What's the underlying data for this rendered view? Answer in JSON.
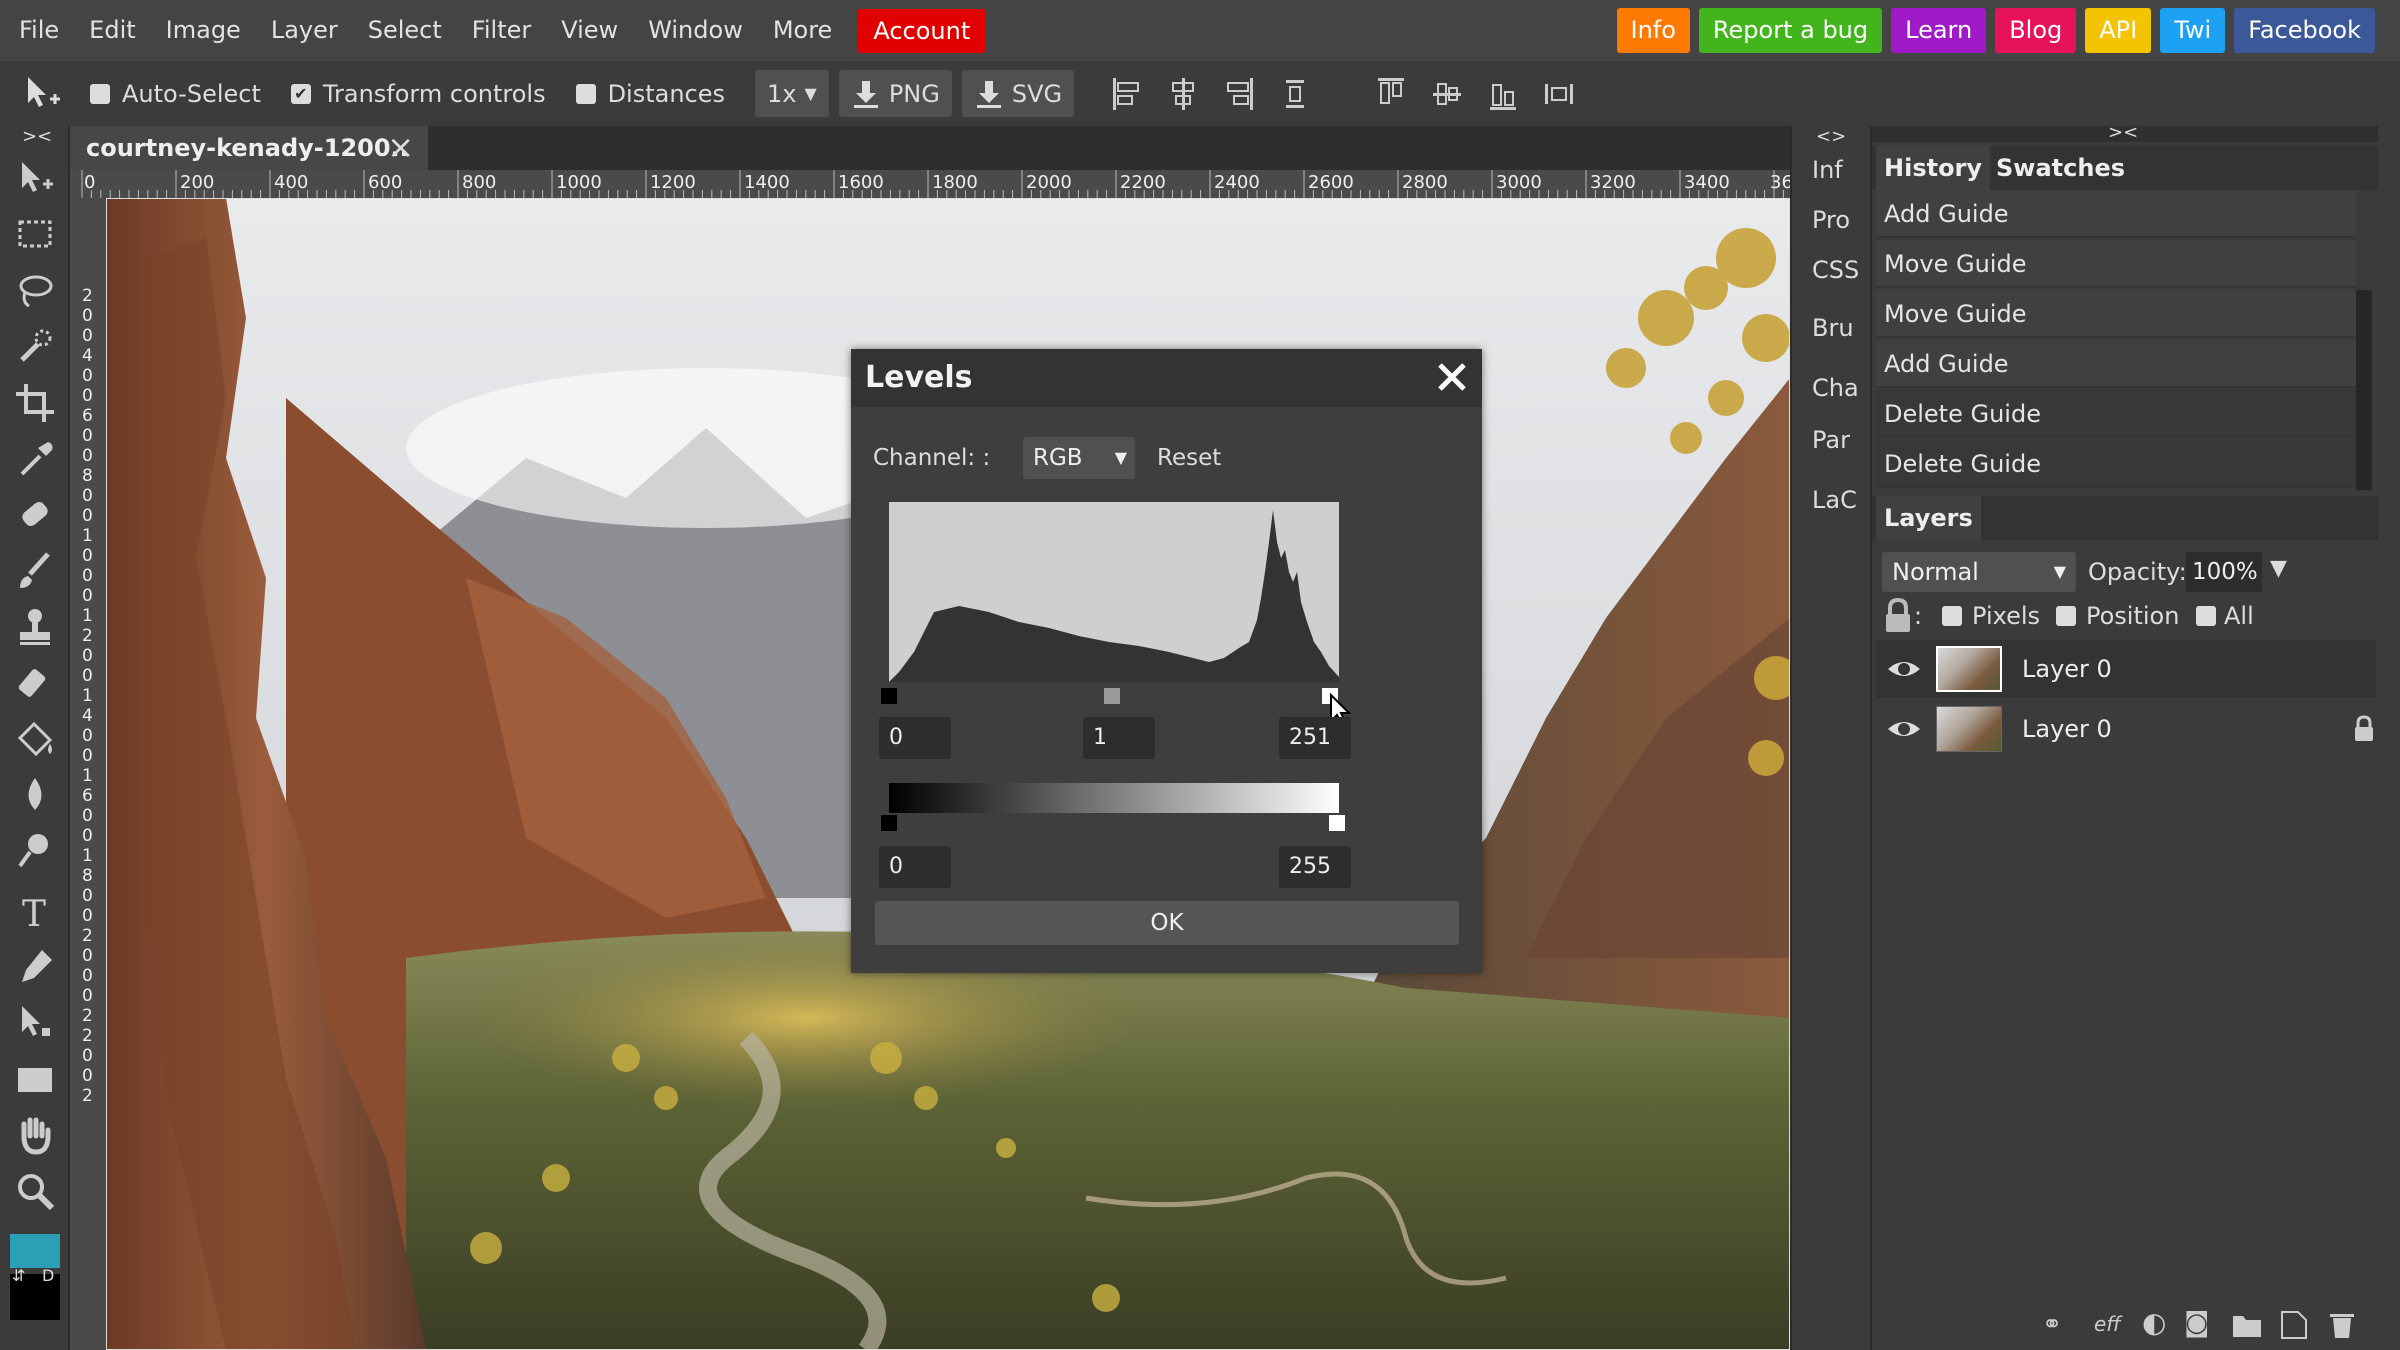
{
  "menu": [
    "File",
    "Edit",
    "Image",
    "Layer",
    "Select",
    "Filter",
    "View",
    "Window",
    "More"
  ],
  "menu_account": "Account",
  "top_links": [
    {
      "label": "Info",
      "color": "#ff7a00"
    },
    {
      "label": "Report a bug",
      "color": "#41b51b"
    },
    {
      "label": "Learn",
      "color": "#a01bc7"
    },
    {
      "label": "Blog",
      "color": "#e8125b"
    },
    {
      "label": "API",
      "color": "#f5c400"
    },
    {
      "label": "Twi",
      "color": "#1da1f2"
    },
    {
      "label": "Facebook",
      "color": "#3b5998"
    }
  ],
  "options": {
    "auto_select": "Auto-Select",
    "auto_select_checked": false,
    "transform_controls": "Transform controls",
    "transform_controls_checked": true,
    "distances": "Distances",
    "distances_checked": false,
    "scale": "1x",
    "export_png": "PNG",
    "export_svg": "SVG"
  },
  "document": {
    "tab_title": "courtney-kenady-1200.."
  },
  "ruler_h": [
    "0",
    "200",
    "400",
    "600",
    "800",
    "1000",
    "1200",
    "1400",
    "1600",
    "1800",
    "2000",
    "2200",
    "2400",
    "2600",
    "2800",
    "3000",
    "3200",
    "3400",
    "36"
  ],
  "ruler_v": [
    "2",
    "0",
    "0",
    "4",
    "0",
    "0",
    "6",
    "0",
    "0",
    "8",
    "0",
    "0",
    "1",
    "0",
    "0",
    "0",
    "1",
    "2",
    "0",
    "0",
    "1",
    "4",
    "0",
    "0",
    "1",
    "6",
    "0",
    "0",
    "1",
    "8",
    "0",
    "0",
    "2",
    "0",
    "0",
    "0",
    "2",
    "2",
    "0",
    "0",
    "2"
  ],
  "mid_panels": [
    "Inf",
    "Pro",
    "CSS",
    "Bru",
    "Cha",
    "Par",
    "LaC"
  ],
  "history_tabs": [
    "History",
    "Swatches"
  ],
  "history": [
    "Add Guide",
    "Move Guide",
    "Move Guide",
    "Add Guide",
    "Delete Guide",
    "Delete Guide"
  ],
  "layers": {
    "title": "Layers",
    "blend": "Normal",
    "opacity_label": "Opacity:",
    "opacity": "100%",
    "lock_pixels": "Pixels",
    "lock_position": "Position",
    "lock_all": "All",
    "rows": [
      {
        "name": "Layer 0",
        "locked": false
      },
      {
        "name": "Layer 0",
        "locked": true
      }
    ]
  },
  "dialog": {
    "title": "Levels",
    "channel_label": "Channel: :",
    "channel_value": "RGB",
    "reset": "Reset",
    "input_black": "0",
    "input_gamma": "1",
    "input_white": "251",
    "output_black": "0",
    "output_white": "255",
    "ok": "OK"
  },
  "colors": {
    "foreground": "#2a9fb5",
    "background": "#000000"
  }
}
